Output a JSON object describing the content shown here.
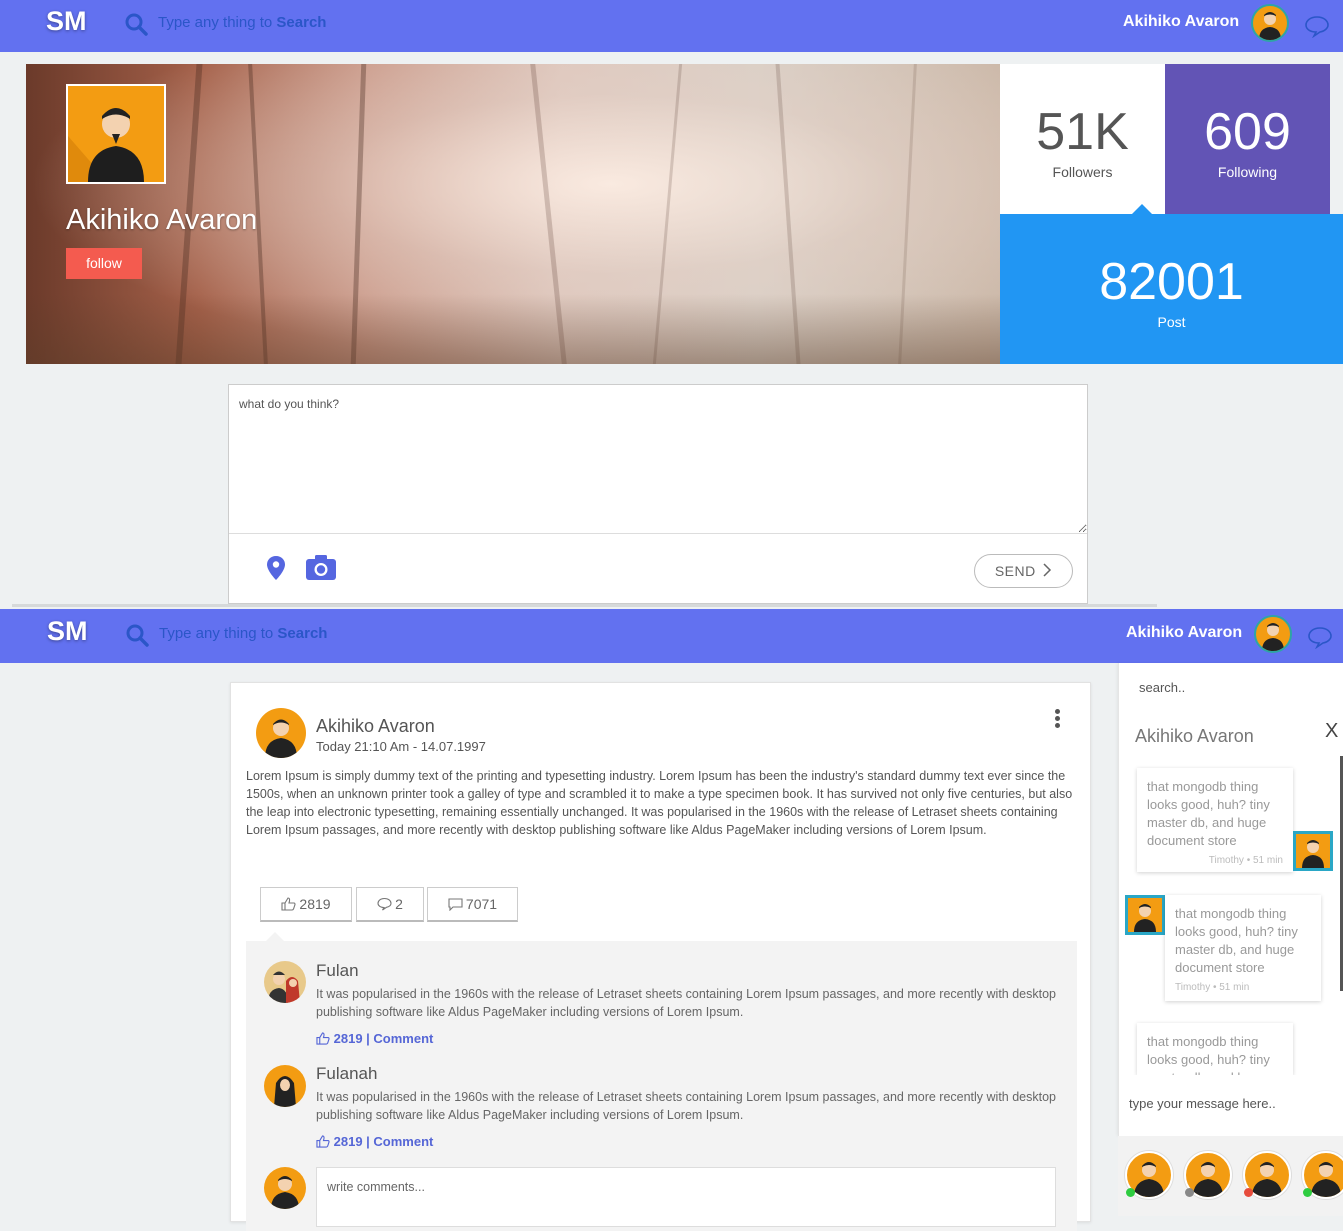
{
  "colors": {
    "navbar": "#6271f0",
    "following": "#6254b5",
    "post": "#2196f3",
    "follow_btn": "#f45b4f",
    "link": "#5566d6"
  },
  "nav": {
    "logo": "SM",
    "search_placeholder": "Type any thing to",
    "search_strong": "Search",
    "user_name": "Akihiko Avaron"
  },
  "profile": {
    "name": "Akihiko Avaron",
    "follow_label": "follow",
    "followers_count": "51K",
    "followers_label": "Followers",
    "following_count": "609",
    "following_label": "Following",
    "post_count": "82001",
    "post_label": "Post"
  },
  "composer": {
    "placeholder": "what do you think?",
    "send_label": "SEND",
    "icons": [
      "map-pin-icon",
      "camera-icon"
    ]
  },
  "post": {
    "author": "Akihiko Avaron",
    "time": "Today 21:10 Am - 14.07.1997",
    "body": "Lorem Ipsum is simply dummy text of the printing and typesetting industry. Lorem Ipsum has been the industry's standard dummy text ever since the 1500s, when an unknown printer took a galley of type and scrambled it to make a type specimen book. It has survived not only five centuries, but also the leap into electronic typesetting, remaining essentially unchanged. It was popularised in the 1960s with the release of Letraset sheets containing Lorem Ipsum passages, and more recently with desktop publishing software like Aldus PageMaker including versions of Lorem Ipsum.",
    "likes": "2819",
    "comments": "2",
    "shares": "7071"
  },
  "comments": [
    {
      "name": "Fulan",
      "text": "It was popularised in the 1960s with the release of Letraset sheets containing Lorem Ipsum passages, and more recently with desktop publishing software like Aldus PageMaker including versions of Lorem Ipsum.",
      "likes": "2819",
      "action": "| Comment"
    },
    {
      "name": "Fulanah",
      "text": "It was popularised in the 1960s with the release of Letraset sheets containing Lorem Ipsum passages, and more recently with desktop publishing software like Aldus PageMaker including versions of Lorem Ipsum.",
      "likes": "2819",
      "action": "| Comment"
    }
  ],
  "comment_input_placeholder": "write comments...",
  "chat": {
    "search_placeholder": "search..",
    "contact_name": "Akihiko Avaron",
    "close_label": "X",
    "messages": [
      {
        "text": "that mongodb thing looks good, huh? tiny master db, and huge document store",
        "meta": "Timothy • 51 min"
      },
      {
        "text": "that mongodb thing looks good, huh? tiny master db, and huge document store",
        "meta": "Timothy • 51 min"
      },
      {
        "text": "that mongodb thing looks good, huh? tiny master db, and huge",
        "meta": ""
      }
    ],
    "input_placeholder": "type your message here..",
    "online_status_colors": [
      "#2ecc40",
      "#888888",
      "#e74c3c",
      "#2ecc40"
    ]
  }
}
